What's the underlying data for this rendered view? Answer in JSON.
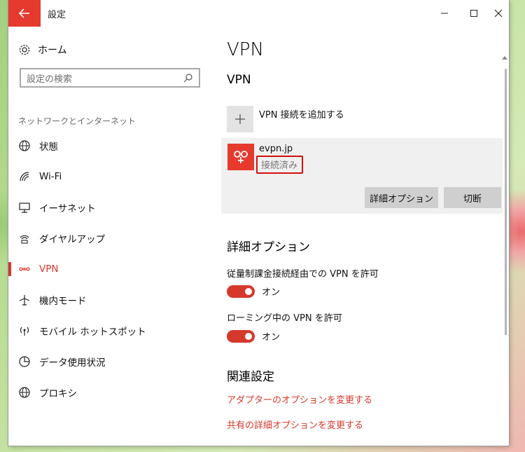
{
  "window": {
    "title": "設定"
  },
  "sidebar": {
    "home_label": "ホーム",
    "search_placeholder": "設定の検索",
    "category": "ネットワークとインターネット",
    "items": [
      {
        "label": "状態",
        "icon": "globe-status-icon"
      },
      {
        "label": "Wi-Fi",
        "icon": "wifi-icon"
      },
      {
        "label": "イーサネット",
        "icon": "ethernet-icon"
      },
      {
        "label": "ダイヤルアップ",
        "icon": "dialup-icon"
      },
      {
        "label": "VPN",
        "icon": "vpn-icon",
        "active": true
      },
      {
        "label": "機内モード",
        "icon": "airplane-icon"
      },
      {
        "label": "モバイル ホットスポット",
        "icon": "hotspot-icon"
      },
      {
        "label": "データ使用状況",
        "icon": "data-usage-icon"
      },
      {
        "label": "プロキシ",
        "icon": "globe-icon"
      }
    ]
  },
  "main": {
    "page_title": "VPN",
    "section_title": "VPN",
    "add_label": "VPN 接続を追加する",
    "connection": {
      "name": "evpn.jp",
      "status": "接続済み",
      "advanced_button": "詳細オプション",
      "disconnect_button": "切断"
    },
    "advanced_title": "詳細オプション",
    "options": [
      {
        "label": "従量制課金接続経由での VPN を許可",
        "toggle": "オン"
      },
      {
        "label": "ローミング中の VPN を許可",
        "toggle": "オン"
      }
    ],
    "related_title": "関連設定",
    "links": [
      "アダプターのオプションを変更する",
      "共有の詳細オプションを変更する"
    ]
  },
  "colors": {
    "accent": "#d6382c",
    "back_button": "#e63a2f",
    "status_box": "#d40f0f"
  }
}
